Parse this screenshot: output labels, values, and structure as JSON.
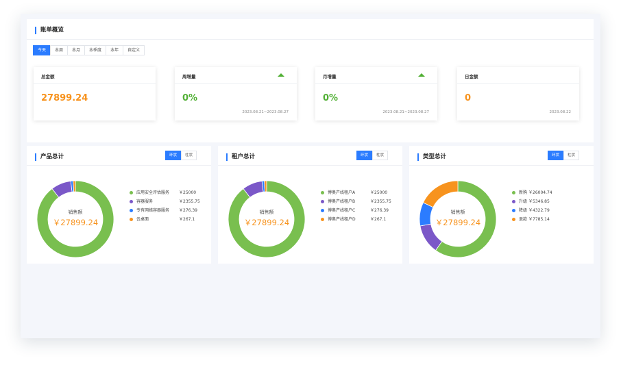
{
  "overview": {
    "title": "账单概览",
    "tabs": [
      {
        "label": "今天",
        "active": true
      },
      {
        "label": "本周",
        "active": false
      },
      {
        "label": "本月",
        "active": false
      },
      {
        "label": "本季度",
        "active": false
      },
      {
        "label": "本年",
        "active": false
      },
      {
        "label": "自定义",
        "active": false
      }
    ],
    "stats": [
      {
        "label": "总金额",
        "value": "27899.24",
        "color": "#f7931e",
        "date": "",
        "trend": ""
      },
      {
        "label": "周增量",
        "value": "0%",
        "color": "#52b035",
        "date": "2023.08.21~2023.08.27",
        "trend": "up"
      },
      {
        "label": "月增量",
        "value": "0%",
        "color": "#52b035",
        "date": "2023.08.21~2023.08.27",
        "trend": "up"
      },
      {
        "label": "日金额",
        "value": "0",
        "color": "#f7931e",
        "date": "2023.08.22",
        "trend": ""
      }
    ]
  },
  "panels": [
    {
      "title": "产品总计",
      "toggle": {
        "ring_label": "环状",
        "bar_label": "柱状"
      },
      "center_label": "销售额",
      "center_value": "￥27899.24",
      "legend": [
        {
          "name": "应用安全评估服务",
          "value": "￥25000"
        },
        {
          "name": "容器服务",
          "value": "￥2355.75"
        },
        {
          "name": "专有网络容器服务",
          "value": "￥276.39"
        },
        {
          "name": "云桌面",
          "value": "￥267.1"
        }
      ]
    },
    {
      "title": "租户总计",
      "toggle": {
        "ring_label": "环状",
        "bar_label": "柱状"
      },
      "center_label": "销售额",
      "center_value": "￥27899.24",
      "legend": [
        {
          "name": "博奥产线租户A",
          "value": "￥25000"
        },
        {
          "name": "博奥产线租户B",
          "value": "￥2355.75"
        },
        {
          "name": "博奥产线租户C",
          "value": "￥276.39"
        },
        {
          "name": "博奥产线租户D",
          "value": "￥267.1"
        }
      ]
    },
    {
      "title": "类型总计",
      "toggle": {
        "ring_label": "环状",
        "bar_label": "柱状"
      },
      "center_label": "销售额",
      "center_value": "￥27899.24",
      "legend": [
        {
          "name": "新购",
          "value": "￥26004.74"
        },
        {
          "name": "升级",
          "value": "￥5346.85"
        },
        {
          "name": "降级",
          "value": "￥4322.79"
        },
        {
          "name": "退款",
          "value": "￥7785.14"
        }
      ]
    }
  ],
  "chart_data": [
    {
      "type": "pie",
      "categories": [
        "应用安全评估服务",
        "容器服务",
        "专有网络容器服务",
        "云桌面"
      ],
      "values": [
        25000,
        2355.75,
        276.39,
        267.1
      ],
      "colors": [
        "#79bf4f",
        "#7b58c8",
        "#2b7cff",
        "#f7931e"
      ]
    },
    {
      "type": "pie",
      "categories": [
        "博奥产线租户A",
        "博奥产线租户B",
        "博奥产线租户C",
        "博奥产线租户D"
      ],
      "values": [
        25000,
        2355.75,
        276.39,
        267.1
      ],
      "colors": [
        "#79bf4f",
        "#7b58c8",
        "#2b7cff",
        "#f7931e"
      ]
    },
    {
      "type": "pie",
      "categories": [
        "新购",
        "升级",
        "降级",
        "退款"
      ],
      "values": [
        26004.74,
        5346.85,
        4322.79,
        7785.14
      ],
      "colors": [
        "#79bf4f",
        "#7b58c8",
        "#2b7cff",
        "#f7931e"
      ]
    }
  ]
}
